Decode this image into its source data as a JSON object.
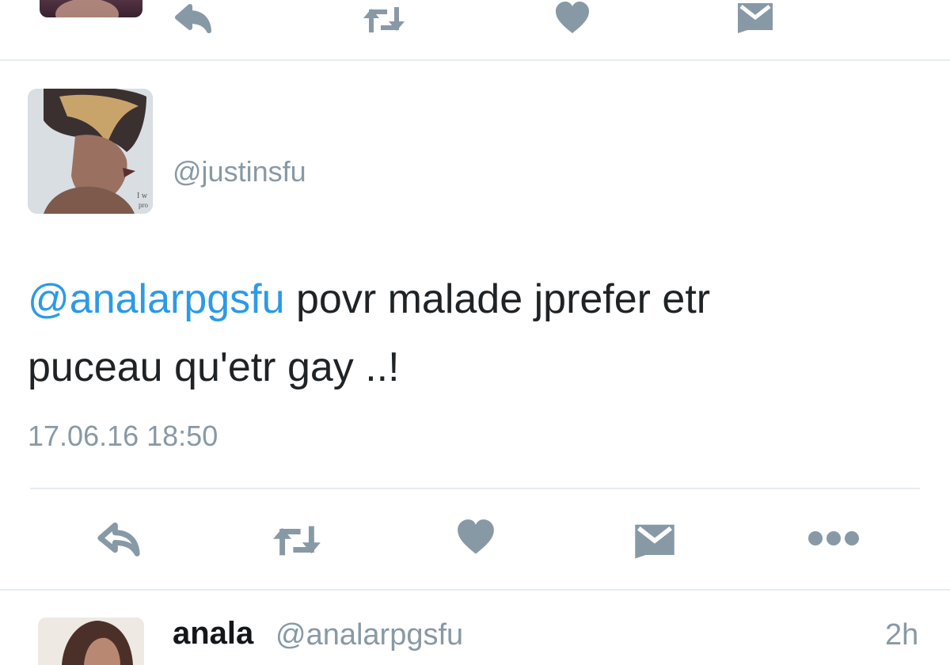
{
  "top_tweet": {
    "actions": [
      "reply-icon",
      "retweet-icon",
      "like-icon",
      "message-icon"
    ]
  },
  "main_tweet": {
    "handle": "@justinsfu",
    "mention": "@analarpgsfu",
    "text_line1": " povr malade jprefer etr",
    "text_line2": "puceau qu'etr gay ..!",
    "timestamp": "17.06.16 18:50",
    "actions": [
      "reply-icon",
      "retweet-icon",
      "like-icon",
      "message-icon",
      "more-icon"
    ]
  },
  "next_tweet": {
    "name": "anala",
    "handle": "@analarpgsfu",
    "time": "2h"
  },
  "colors": {
    "link": "#2b9ae8",
    "icon": "#8899a6",
    "divider": "#e6ecf0"
  }
}
